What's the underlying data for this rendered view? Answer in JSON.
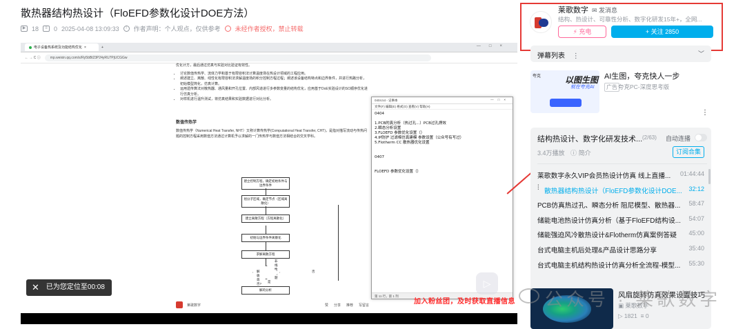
{
  "video": {
    "title": "散热器结构热设计（FloEFD参数化设计DOE方法）",
    "play_count": "18",
    "danmaku_count": "0",
    "date": "2025-04-08 13:09:33",
    "statement": "作者声明：个人观点，仅供参考",
    "no_reprint": "未经作者授权，禁止转载"
  },
  "player": {
    "browser_tab": "电子设备热系统及功能结构优化",
    "url": "mp.weixin.qq.com/s/Ry5bBt23P24yRU7PjUCGGw",
    "article_intro": "优化计方，最后通过仿真与实验对比验证有效性。",
    "article_bullets": [
      "讨论数值传热学、流体力学和基于有限容积法计算温度场在热设计领域的工程应用。",
      "阐述建立、离散、线性化有限容积法求解温度场的积分控制方程过程；阐述该设备结构特点和边界条件，并进行热路分析，初始模型简化，仿真计算。",
      "运用遗传算法对散热器、通风量和开孔位置、内部风道进行多参数变量的结构优化，应用基于DoE实验设计的SO顺序优化进行仿真分析。",
      "对样机进行温升测试，将仿真结果和实验数据进行对比分析。"
    ],
    "article_section": "数值传热学",
    "article_para": "数值传热学（Numerical Heat Transfer, NHT）又称计算传热学(Computational Heat Transfer, CHT)，是指对描写流动与传热问题的控制方程采用数值方法通过计算机予以求解的一门传热学与数值方法相结合的交叉学科。",
    "flow_steps": [
      "建立控制方程，确定初始条件与边界条件",
      "划分子区域，确定节点（区域离散化）",
      "建立离散方程（方程离散化）",
      "初始与边界条件离散化",
      "求解离散方程",
      "解收敛否?",
      "解的分析"
    ],
    "flow_labels": {
      "nonlinear": "非线性问题",
      "yes": "是",
      "no": "否"
    },
    "notepad_title": "0404.txt - 记事本",
    "notepad_menu": "文件(F)  编辑(E)  格式(O)  查看(V)  帮助(H)",
    "notepad_text": "0404\n\n1.PCB的真分析（热过孔...）PCB过孔焊效\n2.瞬态分析设置\n3.FLOEFD 参数优化设置（）\n4.IP防护 过滤棉仿真建模 参数设置（公众号有写过）\n5.Flotherm CC 散热器优化设置\n\n\n0407\n\n\nFLOEFD 参数优化设置（）",
    "notepad_status": "第 11 行，第 1 列",
    "account_name": "莱歌数字",
    "bottom_actions": [
      "赞",
      "分享",
      "推荐",
      "写留言"
    ],
    "resume_text": "已为您定位至00:08",
    "promo_text": "加入粉丝团，及时获取直播信息"
  },
  "author": {
    "name": "莱歌数字",
    "message": "发消息",
    "description": "结构、热设计、可靠性分析、数字化研发15年+，全网...",
    "charge_label": "充电",
    "follow_label": "+ 关注 2850"
  },
  "danmaku_list": {
    "label": "弹幕列表"
  },
  "ad": {
    "thumb_brand": "夸克",
    "thumb_headline": "以图生图",
    "thumb_sub": "就在夸克AI",
    "headline": "AI生图，夸克快人一步",
    "tag": "广告",
    "source": "夸克PC-深度思考版"
  },
  "playlist": {
    "title": "结构热设计、数字化研发技术...",
    "count": "(2/63)",
    "autoplay": "自动连播",
    "views": "3.4万播放",
    "intro": "简介",
    "subscribe": "订阅合集",
    "items": [
      {
        "title": "莱歌数字永久VIP会员热设计仿真 线上直播...",
        "duration": "01:44:44",
        "active": false
      },
      {
        "title": "散热器结构热设计（FloEFD参数化设计DOE...",
        "duration": "32:12",
        "active": true
      },
      {
        "title": "PCB仿真热过孔、瞬态分析 阻尼模型、散热器...",
        "duration": "58:47",
        "active": false
      },
      {
        "title": "储能电池热设计仿真分析（基于FloEFD结构设...",
        "duration": "54:07",
        "active": false
      },
      {
        "title": "储能强迫风冷散热设计&Flotherm仿真案例答疑",
        "duration": "45:00",
        "active": false
      },
      {
        "title": "台式电脑主机后处理&产品设计思路分享",
        "duration": "35:40",
        "active": false
      },
      {
        "title": "台式电脑主机结构热设计仿真分析全流程-模型...",
        "duration": "55:30",
        "active": false
      }
    ]
  },
  "recommend": {
    "title": "风扇旋转仿真效果设置技巧",
    "uploader": "莱歌数字",
    "plays": "1821",
    "danmaku": "0"
  },
  "watermark": "公众号 · 莱歌数字",
  "colors": {
    "accent": "#00aeec",
    "highlight_border": "#e53935",
    "charge": "#ff6699",
    "promo": "#ff2a2a"
  }
}
